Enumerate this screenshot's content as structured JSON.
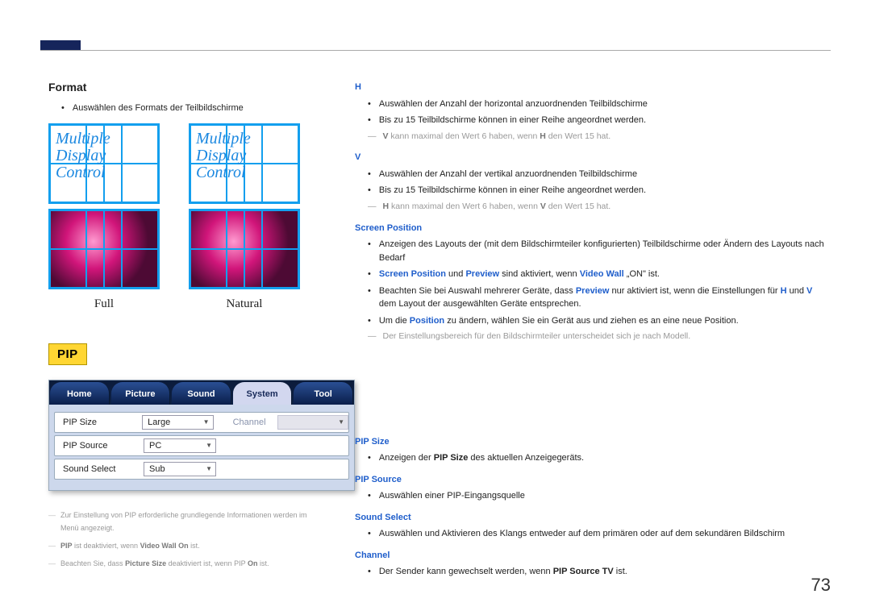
{
  "page_number": "73",
  "left": {
    "format_heading": "Format",
    "format_bullet": "Auswählen des Formats der Teilbildschirme",
    "panel_text_line1": "Multiple",
    "panel_text_line2": "Display",
    "panel_text_line3": "Control",
    "full_label": "Full",
    "natural_label": "Natural",
    "pip_badge": "PIP",
    "tabs": {
      "home": "Home",
      "picture": "Picture",
      "sound": "Sound",
      "system": "System",
      "tool": "Tool"
    },
    "rows": {
      "pip_size_label": "PIP Size",
      "pip_size_value": "Large",
      "pip_source_label": "PIP Source",
      "pip_source_value": "PC",
      "sound_select_label": "Sound Select",
      "sound_select_value": "Sub",
      "channel_col": "Channel"
    },
    "footnotes": {
      "f1_a": "Zur Einstellung von PIP erforderliche grundlegende Informationen werden im Menü angezeigt.",
      "f2_a": "PIP",
      "f2_b": " ist deaktiviert, wenn ",
      "f2_c": "Video Wall On",
      "f2_d": " ist.",
      "f3_a": "Beachten Sie, dass ",
      "f3_b": "Picture Size",
      "f3_c": " deaktiviert ist, wenn PIP ",
      "f3_d": "On",
      "f3_e": " ist."
    }
  },
  "right": {
    "h_heading": "H",
    "h_b1": "Auswählen der Anzahl der horizontal anzuordnenden Teilbildschirme",
    "h_b2": "Bis zu 15 Teilbildschirme können in einer Reihe angeordnet werden.",
    "h_note_1a": "V",
    "h_note_1b": " kann maximal den Wert 6 haben, wenn ",
    "h_note_1c": "H",
    "h_note_1d": " den Wert 15 hat.",
    "v_heading": "V",
    "v_b1": "Auswählen der Anzahl der vertikal anzuordnenden Teilbildschirme",
    "v_b2": "Bis zu 15 Teilbildschirme können in einer Reihe angeordnet werden.",
    "v_note_1a": "H",
    "v_note_1b": " kann maximal den Wert 6 haben, wenn ",
    "v_note_1c": "V",
    "v_note_1d": " den Wert 15 hat.",
    "sp_heading": "Screen Position",
    "sp_b1": "Anzeigen des Layouts der (mit dem Bildschirmteiler konfigurierten) Teilbildschirme oder Ändern des Layouts nach Bedarf",
    "sp_b2_a": "Screen Position",
    "sp_b2_b": " und ",
    "sp_b2_c": "Preview",
    "sp_b2_d": " sind aktiviert, wenn ",
    "sp_b2_e": "Video Wall",
    "sp_b2_f": " „ON\" ist.",
    "sp_b3_a": "Beachten Sie bei Auswahl mehrerer Geräte, dass ",
    "sp_b3_b": "Preview",
    "sp_b3_c": " nur aktiviert ist, wenn die Einstellungen für ",
    "sp_b3_d": "H",
    "sp_b3_e": " und ",
    "sp_b3_f": "V",
    "sp_b3_g": " dem Layout der ausgewählten Geräte entsprechen.",
    "sp_b4_a": "Um die ",
    "sp_b4_b": "Position",
    "sp_b4_c": " zu ändern, wählen Sie ein Gerät aus und ziehen es an eine neue Position.",
    "sp_note": "Der Einstellungsbereich für den Bildschirmteiler unterscheidet sich je nach Modell.",
    "pipsize_heading": "PIP Size",
    "pipsize_b1_a": "Anzeigen der ",
    "pipsize_b1_b": "PIP Size",
    "pipsize_b1_c": " des aktuellen Anzeigegeräts.",
    "pipsource_heading": "PIP Source",
    "pipsource_b1": "Auswählen einer PIP-Eingangsquelle",
    "ss_heading": "Sound Select",
    "ss_b1": "Auswählen und Aktivieren des Klangs entweder auf dem primären oder auf dem sekundären Bildschirm",
    "ch_heading": "Channel",
    "ch_b1_a": "Der Sender kann gewechselt werden, wenn ",
    "ch_b1_b": "PIP Source TV",
    "ch_b1_c": " ist."
  }
}
